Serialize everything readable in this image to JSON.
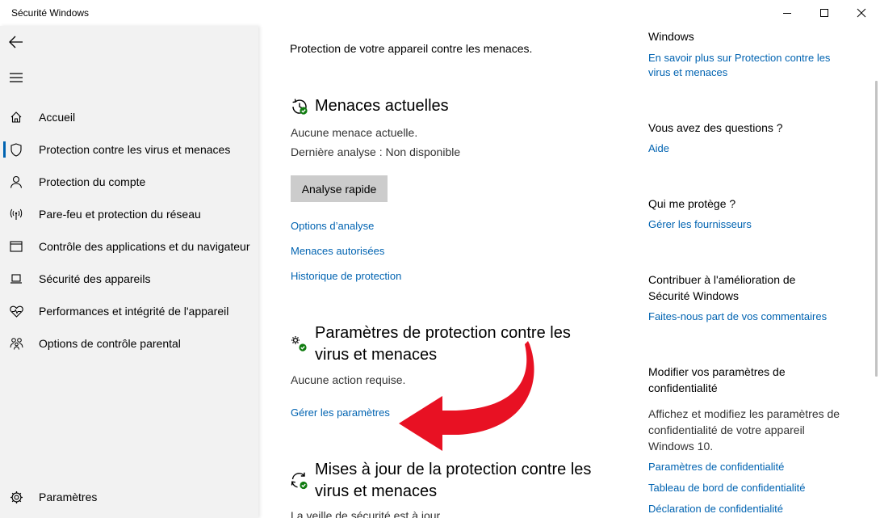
{
  "window": {
    "title": "Sécurité Windows",
    "controls": [
      "minimize",
      "maximize",
      "close"
    ]
  },
  "sidebar": {
    "back_icon": "back-arrow-icon",
    "menu_icon": "hamburger-icon",
    "items": [
      {
        "label": "Accueil",
        "icon": "home-icon",
        "active": false
      },
      {
        "label": "Protection contre les virus et menaces",
        "icon": "shield-icon",
        "active": true
      },
      {
        "label": "Protection du compte",
        "icon": "person-icon",
        "active": false
      },
      {
        "label": "Pare-feu et protection du réseau",
        "icon": "antenna-icon",
        "active": false
      },
      {
        "label": "Contrôle des applications et du navigateur",
        "icon": "app-window-icon",
        "active": false
      },
      {
        "label": "Sécurité des appareils",
        "icon": "laptop-icon",
        "active": false
      },
      {
        "label": "Performances et intégrité de l'appareil",
        "icon": "heart-icon",
        "active": false
      },
      {
        "label": "Options de contrôle parental",
        "icon": "family-icon",
        "active": false
      }
    ],
    "settings": {
      "label": "Paramètres",
      "icon": "gear-icon"
    }
  },
  "main": {
    "intro": "Protection de votre appareil contre les menaces.",
    "threats": {
      "title": "Menaces actuelles",
      "line1": "Aucune menace actuelle.",
      "line2": "Dernière analyse : Non disponible",
      "button": "Analyse rapide",
      "links": [
        "Options d’analyse",
        "Menaces autorisées",
        "Historique de protection"
      ]
    },
    "settings": {
      "title_line1": "Paramètres de protection contre les",
      "title_line2": "virus et menaces",
      "status": "Aucune action requise.",
      "link": "Gérer les paramètres"
    },
    "updates": {
      "title_line1": "Mises à jour de la protection contre les",
      "title_line2": "virus et menaces",
      "status": "La veille de sécurité est à jour."
    }
  },
  "right": {
    "windows_heading": "Windows",
    "learn_more": "En savoir plus sur Protection contre les virus et menaces",
    "questions_heading": "Vous avez des questions ?",
    "help_link": "Aide",
    "who_heading": "Qui me protège ?",
    "providers_link": "Gérer les fournisseurs",
    "contribute_heading": "Contribuer à l'amélioration de Sécurité Windows",
    "feedback_link": "Faites-nous part de vos commentaires",
    "privacy_heading": "Modifier vos paramètres de confidentialité",
    "privacy_text": "Affichez et modifiez les paramètres de confidentialité de votre appareil Windows 10.",
    "privacy_links": [
      "Paramètres de confidentialité",
      "Tableau de bord de confidentialité",
      "Déclaration de confidentialité"
    ]
  },
  "colors": {
    "accent": "#0063b1",
    "status_green": "#107c10",
    "annotation_arrow": "#e81123",
    "sidebar_bg": "#f2f2f2",
    "button_bg": "#cccccc"
  }
}
